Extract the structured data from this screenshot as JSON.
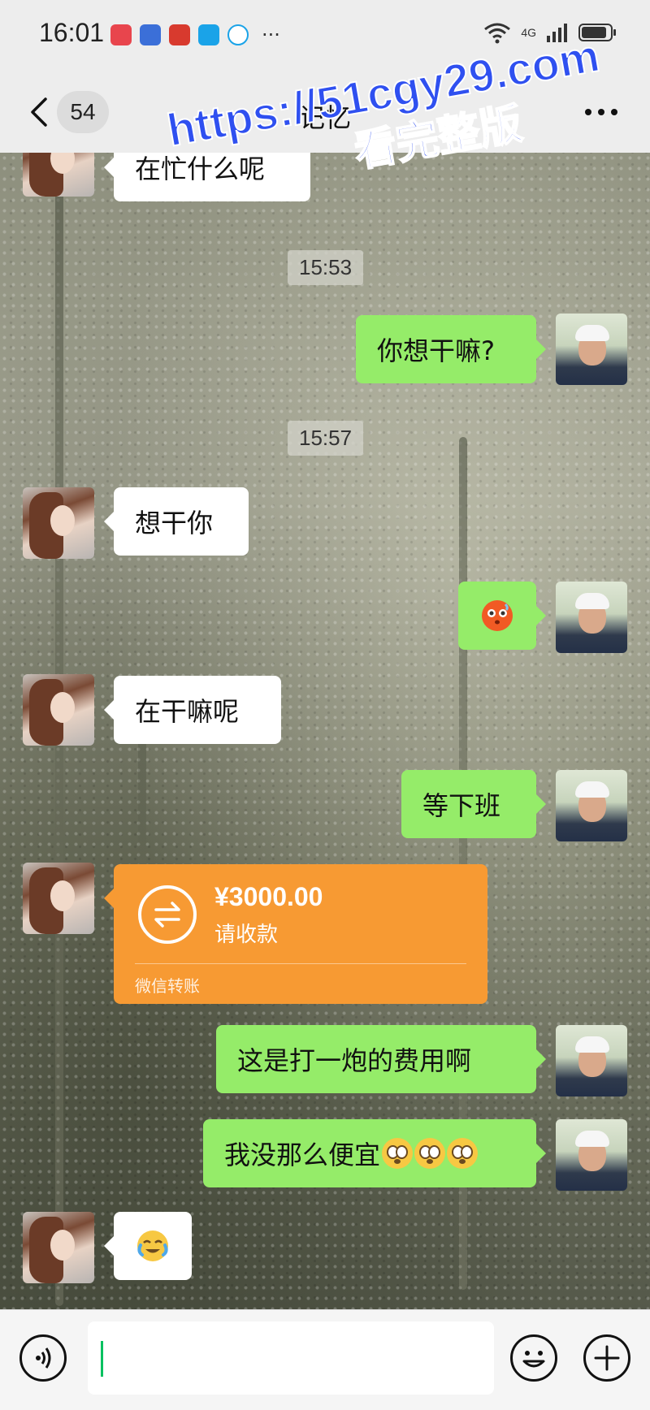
{
  "status_bar": {
    "time": "16:01",
    "dots": "···",
    "network": "4G"
  },
  "nav": {
    "unread_count": "54",
    "title": "记忆"
  },
  "watermark": {
    "url": "https://51cgy29.com",
    "caption": "看完整版"
  },
  "messages": [
    {
      "side": "left",
      "text": "在忙什么呢"
    },
    {
      "type": "time",
      "text": "15:53"
    },
    {
      "side": "right",
      "text": "你想干嘛?"
    },
    {
      "type": "time",
      "text": "15:57"
    },
    {
      "side": "left",
      "text": "想干你"
    },
    {
      "side": "right",
      "emoji": "blushing-face"
    },
    {
      "side": "left",
      "text": "在干嘛呢"
    },
    {
      "side": "right",
      "text": "等下班"
    },
    {
      "side": "left",
      "type": "transfer",
      "amount": "¥3000.00",
      "status": "请收款",
      "label": "微信转账"
    },
    {
      "side": "right",
      "text": "这是打一炮的费用啊"
    },
    {
      "side": "right",
      "text": "我没那么便宜",
      "emoji": "flushed-face",
      "emoji_count": 3
    },
    {
      "side": "left",
      "emoji": "crying-laughing-face"
    }
  ],
  "colors": {
    "bubble_right": "#95ec69",
    "bubble_left": "#ffffff",
    "transfer": "#f79a33",
    "watermark": "#2f50f0",
    "caret": "#07c160"
  },
  "input": {
    "value": ""
  }
}
